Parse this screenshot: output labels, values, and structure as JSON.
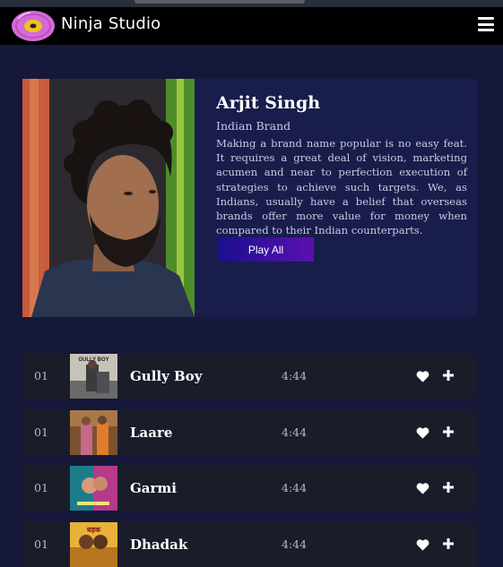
{
  "header": {
    "brand": "Ninja Studio",
    "logo_icon": "vinyl-record-icon",
    "menu_icon": "hamburger-menu-icon"
  },
  "artist": {
    "name": "Arjit Singh",
    "subtitle": "Indian Brand",
    "description": "Making a brand name popular is no easy feat. It requires a great deal of vision, marketing acumen and near to perfection execution of strategies to achieve such targets. We, as Indians, usually have a belief that overseas brands offer more value for money when compared to their Indian counterparts.",
    "play_all_label": "Play All"
  },
  "tracks": [
    {
      "number": "01",
      "title": "Gully Boy",
      "duration": "4:44",
      "thumb_text": "GULLY BOY"
    },
    {
      "number": "01",
      "title": "Laare",
      "duration": "4:44",
      "thumb_text": ""
    },
    {
      "number": "01",
      "title": "Garmi",
      "duration": "4:44",
      "thumb_text": ""
    },
    {
      "number": "01",
      "title": "Dhadak",
      "duration": "4:44",
      "thumb_text": "धड़क"
    }
  ],
  "colors": {
    "page_bg": "#151838",
    "header_bg": "#000000",
    "hero_bg": "#181d4c",
    "track_bg": "#1b1c2a",
    "accent_gradient_start": "#1a0f8e",
    "accent_gradient_end": "#5a10b0"
  },
  "icons": {
    "favorite": "heart-icon",
    "add": "plus-icon"
  }
}
